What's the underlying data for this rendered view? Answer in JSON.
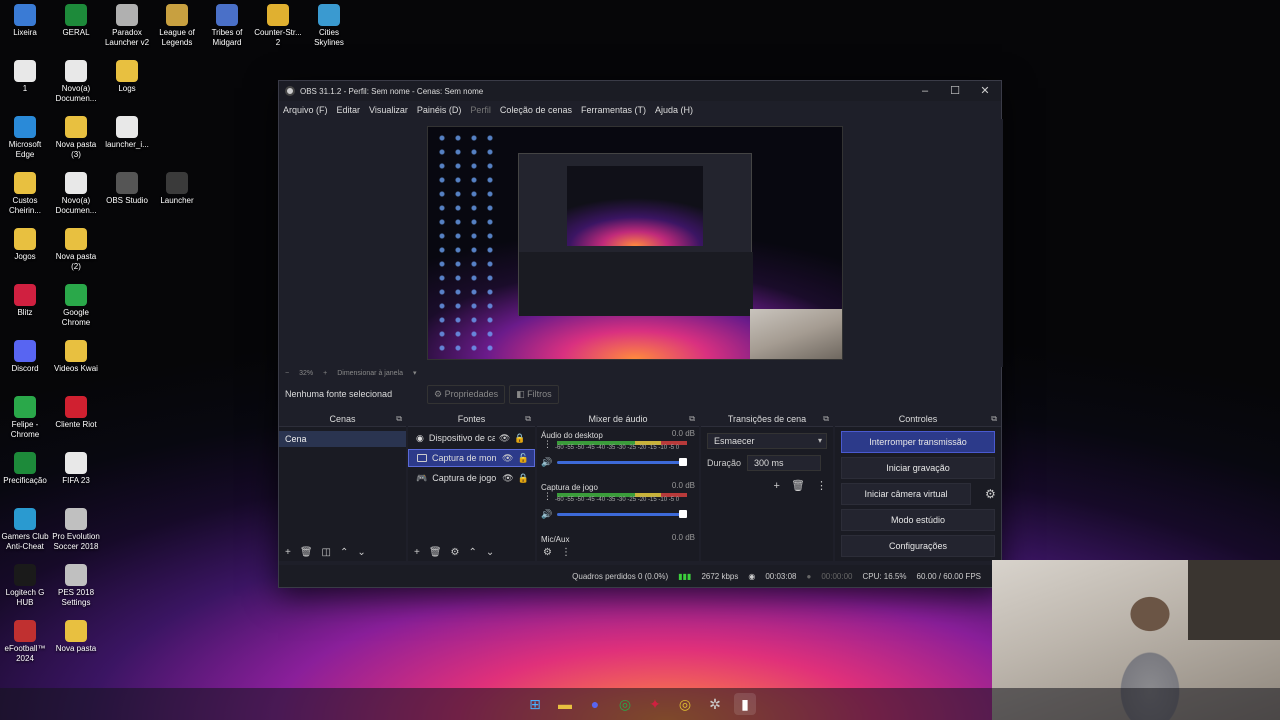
{
  "desktop": {
    "icons": [
      {
        "label": "Lixeira",
        "color": "#3a7bd5"
      },
      {
        "label": "GERAL",
        "color": "#1d8a3a"
      },
      {
        "label": "Paradox Launcher v2",
        "color": "#b0b0b0"
      },
      {
        "label": "League of Legends",
        "color": "#c8a040"
      },
      {
        "label": "Tribes of Midgard",
        "color": "#4a70c8"
      },
      {
        "label": "Counter-Str... 2",
        "color": "#e0b030"
      },
      {
        "label": "Cities Skylines",
        "color": "#3a9ad0"
      },
      {
        "label": "1",
        "color": "#e8e8e8"
      },
      {
        "label": "Novo(a) Documen...",
        "color": "#e8e8e8"
      },
      {
        "label": "Logs",
        "color": "#e8c040"
      },
      {
        "label": "Microsoft Edge",
        "color": "#2a8ad8"
      },
      {
        "label": "Nova pasta (3)",
        "color": "#e8c040"
      },
      {
        "label": "launcher_i...",
        "color": "#e8e8e8"
      },
      {
        "label": "Custos Cheirin...",
        "color": "#e8c040"
      },
      {
        "label": "Novo(a) Documen...",
        "color": "#e8e8e8"
      },
      {
        "label": "OBS Studio",
        "color": "#555555"
      },
      {
        "label": "Launcher",
        "color": "#3a3a3a"
      },
      {
        "label": "Jogos",
        "color": "#e8c040"
      },
      {
        "label": "Nova pasta (2)",
        "color": "#e8c040"
      },
      {
        "label": "Blitz",
        "color": "#d02040"
      },
      {
        "label": "Google Chrome",
        "color": "#2aa84a"
      },
      {
        "label": "Discord",
        "color": "#5865f2"
      },
      {
        "label": "Videos Kwai",
        "color": "#e8c040"
      },
      {
        "label": "Felipe - Chrome",
        "color": "#2aa84a"
      },
      {
        "label": "Cliente Riot",
        "color": "#d02030"
      },
      {
        "label": "Precificação",
        "color": "#1d8a3a"
      },
      {
        "label": "FIFA 23",
        "color": "#e8e8e8"
      },
      {
        "label": "Gamers Club Anti-Cheat",
        "color": "#2a9ad0"
      },
      {
        "label": "Pro Evolution Soccer 2018",
        "color": "#c0c0c0"
      },
      {
        "label": "Logitech G HUB",
        "color": "#1a1a1a"
      },
      {
        "label": "PES 2018 Settings",
        "color": "#c0c0c0"
      },
      {
        "label": "eFootball™ 2024",
        "color": "#c03030"
      },
      {
        "label": "Nova pasta",
        "color": "#e8c040"
      }
    ]
  },
  "obs": {
    "title": "OBS 31.1.2 - Perfil: Sem nome - Cenas: Sem nome",
    "menu": [
      {
        "label": "Arquivo (F)",
        "disabled": false
      },
      {
        "label": "Editar",
        "disabled": false
      },
      {
        "label": "Visualizar",
        "disabled": false
      },
      {
        "label": "Painéis (D)",
        "disabled": false
      },
      {
        "label": "Perfil",
        "disabled": true
      },
      {
        "label": "Coleção de cenas",
        "disabled": false
      },
      {
        "label": "Ferramentas (T)",
        "disabled": false
      },
      {
        "label": "Ajuda (H)",
        "disabled": false
      }
    ],
    "preview_toolbar": {
      "zoom": "32%",
      "fit": "Dimensionar à janela"
    },
    "source_toolbar": {
      "no_source": "Nenhuma fonte selecionad",
      "properties": "Propriedades",
      "filters": "Filtros"
    },
    "docks": {
      "scenes": {
        "title": "Cenas",
        "items": [
          "Cena"
        ]
      },
      "sources": {
        "title": "Fontes",
        "items": [
          {
            "name": "Dispositivo de ca",
            "icon": "camera-icon"
          },
          {
            "name": "Captura de mon",
            "icon": "monitor-icon"
          },
          {
            "name": "Captura de jogo",
            "icon": "gamepad-icon"
          }
        ]
      },
      "mixer": {
        "title": "Mixer de áudio",
        "channels": [
          {
            "name": "Áudio do desktop",
            "db": "0.0 dB"
          },
          {
            "name": "Captura de jogo",
            "db": "0.0 dB"
          },
          {
            "name": "Mic/Aux",
            "db": "0.0 dB"
          }
        ],
        "scale": "-60 -55 -50 -45 -40 -35 -30 -25 -20 -15 -10 -5 0"
      },
      "transitions": {
        "title": "Transições de cena",
        "selected": "Esmaecer",
        "duration_label": "Duração",
        "duration_value": "300 ms"
      },
      "controls": {
        "title": "Controles",
        "buttons": {
          "stream": "Interromper transmissão",
          "record": "Iniciar gravação",
          "virtual_cam": "Iniciar câmera virtual",
          "studio": "Modo estúdio",
          "settings": "Configurações"
        }
      }
    },
    "status": {
      "dropped": "Quadros perdidos 0 (0.0%)",
      "bitrate": "2672 kbps",
      "stream_time": "00:03:08",
      "rec_time": "00:00:00",
      "cpu": "CPU: 16.5%",
      "fps": "60.00 / 60.00 FPS"
    }
  }
}
